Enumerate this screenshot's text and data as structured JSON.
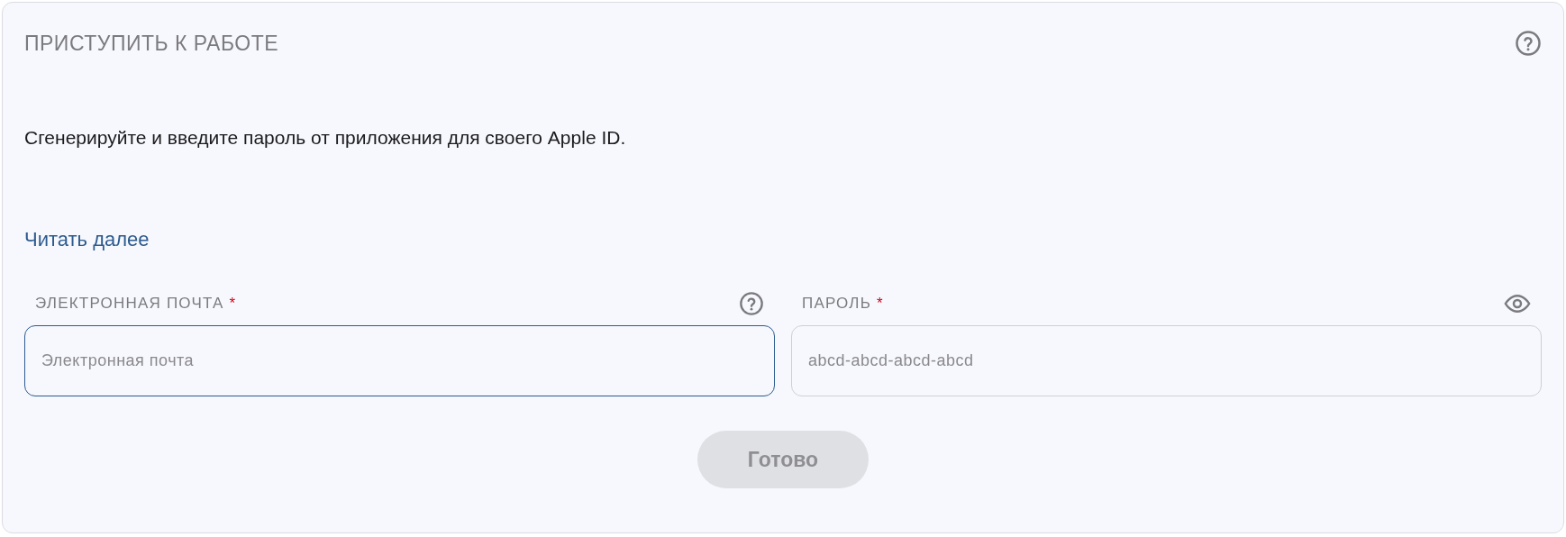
{
  "card": {
    "title": "ПРИСТУПИТЬ К РАБОТЕ",
    "description": "Сгенерируйте и введите пароль от приложения для своего Apple ID.",
    "link": "Читать далее",
    "fields": [
      {
        "label": "ЭЛЕКТРОННАЯ ПОЧТА",
        "required_mark": "*",
        "placeholder": "Электронная почта",
        "focused": true,
        "kind": "help"
      },
      {
        "label": "ПАРОЛЬ",
        "required_mark": "*",
        "placeholder": "abcd-abcd-abcd-abcd",
        "focused": false,
        "kind": "reveal"
      }
    ],
    "submit": {
      "label": "Готово",
      "disabled": true
    }
  }
}
